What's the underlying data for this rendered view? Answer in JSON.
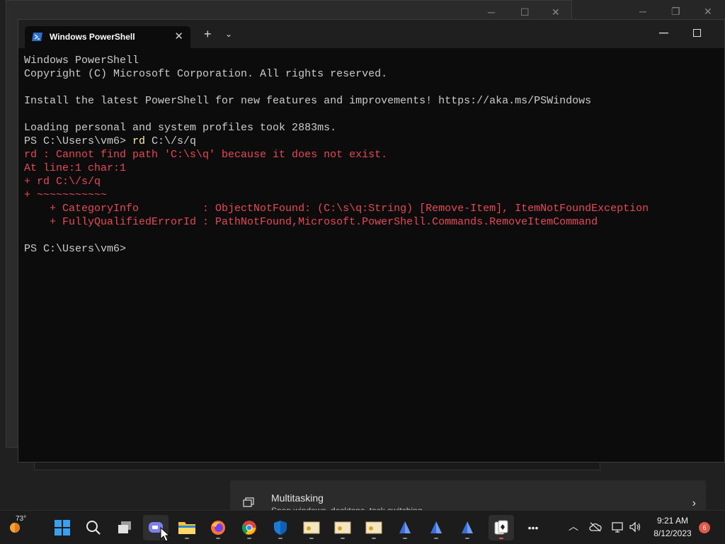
{
  "terminal": {
    "tab_title": "Windows PowerShell",
    "new_tab_glyph": "+",
    "lines": [
      {
        "text": "Windows PowerShell",
        "type": "normal"
      },
      {
        "text": "Copyright (C) Microsoft Corporation. All rights reserved.",
        "type": "normal"
      },
      {
        "text": "",
        "type": "normal"
      },
      {
        "text": "Install the latest PowerShell for new features and improvements! https://aka.ms/PSWindows",
        "type": "normal"
      },
      {
        "text": "",
        "type": "normal"
      },
      {
        "text": "Loading personal and system profiles took 2883ms.",
        "type": "normal"
      },
      {
        "prompt": "PS C:\\Users\\vm6> ",
        "command": "rd",
        "args": " C:\\/s/q",
        "type": "command"
      },
      {
        "text": "rd : Cannot find path 'C:\\s\\q' because it does not exist.",
        "type": "error"
      },
      {
        "text": "At line:1 char:1",
        "type": "error"
      },
      {
        "text": "+ rd C:\\/s/q",
        "type": "error"
      },
      {
        "text": "+ ~~~~~~~~~~~",
        "type": "error"
      },
      {
        "text": "    + CategoryInfo          : ObjectNotFound: (C:\\s\\q:String) [Remove-Item], ItemNotFoundException",
        "type": "error"
      },
      {
        "text": "    + FullyQualifiedErrorId : PathNotFound,Microsoft.PowerShell.Commands.RemoveItemCommand",
        "type": "error"
      },
      {
        "text": "",
        "type": "normal"
      },
      {
        "text": "PS C:\\Users\\vm6>",
        "type": "normal"
      }
    ]
  },
  "settings_card": {
    "title": "Multitasking",
    "subtitle": "Snap windows, desktops, task switching"
  },
  "taskbar": {
    "weather_temp": "73°",
    "apps": [
      "start",
      "search",
      "task-view",
      "teams-chat",
      "file-explorer",
      "firefox",
      "chrome",
      "defender",
      "certificate-1",
      "certificate-2",
      "certificate-3",
      "app-1",
      "app-2",
      "app-3",
      "solitaire"
    ],
    "more_glyph": "•••",
    "clock_time": "9:21 AM",
    "clock_date": "8/12/2023",
    "notification_count": "6"
  },
  "colors": {
    "terminal_bg": "#0c0c0c",
    "text": "#cccccc",
    "error": "#e74856",
    "command": "#f9f1a5",
    "taskbar_bg": "#1c1c1c"
  }
}
